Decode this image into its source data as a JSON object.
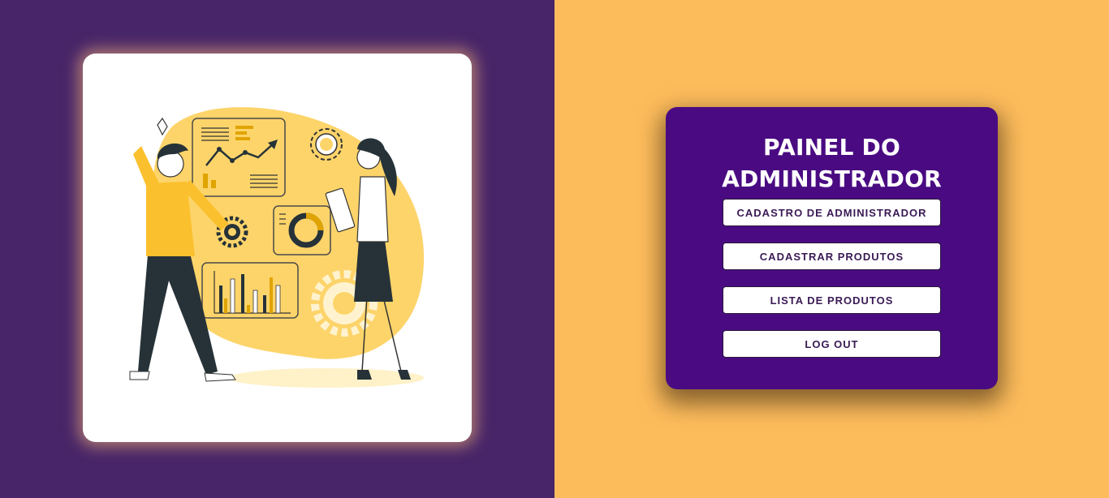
{
  "panel": {
    "title_line1": "PAINEL DO",
    "title_line2": "ADMINISTRADOR",
    "buttons": [
      {
        "label": "CADASTRO DE ADMINISTRADOR"
      },
      {
        "label": "CADASTRAR PRODUTOS"
      },
      {
        "label": "LISTA DE PRODUTOS"
      },
      {
        "label": "LOG OUT"
      }
    ]
  },
  "illustration": {
    "icon": "team-analytics-illustration"
  },
  "colors": {
    "left_background": "#482568",
    "right_background": "#fdbc5c",
    "panel_background": "#4a0b82",
    "button_background": "#ffffff",
    "button_text": "#3a1a55",
    "illustration_accent": "#fdd46a"
  }
}
